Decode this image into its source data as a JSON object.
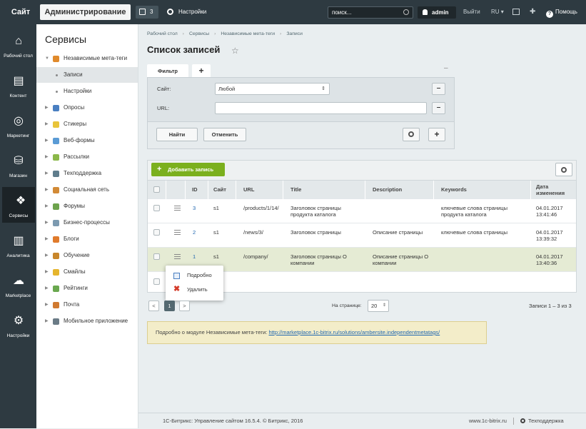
{
  "topbar": {
    "site_label": "Сайт",
    "admin_label": "Администрирование",
    "notifications_count": "3",
    "settings_label": "Настройки",
    "search_placeholder": "поиск...",
    "user_name": "admin",
    "logout_label": "Выйти",
    "lang_label": "RU",
    "help_label": "Помощь"
  },
  "leftnav": [
    {
      "label": "Рабочий стол",
      "icon": "home-icon"
    },
    {
      "label": "Контент",
      "icon": "document-icon"
    },
    {
      "label": "Маркетинг",
      "icon": "target-icon"
    },
    {
      "label": "Магазин",
      "icon": "basket-icon"
    },
    {
      "label": "Сервисы",
      "icon": "layers-icon",
      "active": true
    },
    {
      "label": "Аналитика",
      "icon": "bar-chart-icon"
    },
    {
      "label": "Marketplace",
      "icon": "cloud-download-icon"
    },
    {
      "label": "Настройки",
      "icon": "gear-icon"
    }
  ],
  "sidebar": {
    "title": "Сервисы",
    "items": [
      {
        "label": "Независимые мета-теги",
        "icon": "tag-icon",
        "color": "#e08a2c",
        "expanded": true
      },
      {
        "label": "Записи",
        "sub": true,
        "active": true
      },
      {
        "label": "Настройки",
        "sub": true
      },
      {
        "label": "Опросы",
        "icon": "pie-icon",
        "color": "#4a7fc1"
      },
      {
        "label": "Стикеры",
        "icon": "sticker-icon",
        "color": "#e8c43a"
      },
      {
        "label": "Веб-формы",
        "icon": "form-icon",
        "color": "#5a9bd5"
      },
      {
        "label": "Рассылки",
        "icon": "mail-icon",
        "color": "#8bb84a"
      },
      {
        "label": "Техподдержка",
        "icon": "headset-icon",
        "color": "#5f7d8c"
      },
      {
        "label": "Социальная сеть",
        "icon": "people-icon",
        "color": "#d28a36"
      },
      {
        "label": "Форумы",
        "icon": "forum-icon",
        "color": "#6da34d"
      },
      {
        "label": "Бизнес-процессы",
        "icon": "process-icon",
        "color": "#7c9ab0"
      },
      {
        "label": "Блоги",
        "icon": "blog-icon",
        "color": "#e07b2c"
      },
      {
        "label": "Обучение",
        "icon": "book-icon",
        "color": "#c8862b"
      },
      {
        "label": "Смайлы",
        "icon": "smile-icon",
        "color": "#e5b52d"
      },
      {
        "label": "Рейтинги",
        "icon": "rating-icon",
        "color": "#6aa84f"
      },
      {
        "label": "Почта",
        "icon": "post-icon",
        "color": "#d07a30"
      },
      {
        "label": "Мобильное приложение",
        "icon": "mobile-icon",
        "color": "#6a7b86"
      }
    ]
  },
  "breadcrumbs": [
    "Рабочий стол",
    "Сервисы",
    "Независимые мета-теги",
    "Записи"
  ],
  "page_title": "Список записей",
  "filter": {
    "tab_label": "Фильтр",
    "add_tab_label": "+",
    "collapse_label": "–",
    "site_label": "Сайт:",
    "site_value": "Любой",
    "url_label": "URL:",
    "url_value": "",
    "find_label": "Найти",
    "cancel_label": "Отменить"
  },
  "grid": {
    "add_label": "Добавить запись",
    "columns": [
      "ID",
      "Сайт",
      "URL",
      "Title",
      "Description",
      "Keywords",
      "Дата изменения"
    ],
    "rows": [
      {
        "id": "3",
        "site": "s1",
        "url": "/products/1/14/",
        "title": "Заголовок страницы продукта каталога",
        "description": "",
        "keywords": "ключевые слова страницы продукта каталога",
        "date": "04.01.2017 13:41:46"
      },
      {
        "id": "2",
        "site": "s1",
        "url": "/news/3/",
        "title": "Заголовок страницы",
        "description": "Описание страницы",
        "keywords": "ключевые слова страницы",
        "date": "04.01.2017 13:39:32"
      },
      {
        "id": "1",
        "site": "s1",
        "url": "/company/",
        "title": "Заголовок страницы О компании",
        "description": "Описание страницы О компании",
        "keywords": "",
        "date": "04.01.2017 13:40:36"
      }
    ]
  },
  "context_menu": {
    "details_label": "Подробно",
    "delete_label": "Удалить"
  },
  "pagination": {
    "prev": "<",
    "current": "1",
    "next": ">",
    "per_page_label": "На странице:",
    "per_page_value": "20",
    "total_label": "Записи 1 – 3 из 3"
  },
  "info": {
    "text": "Подробно о модуле Независимые мета-теги:",
    "link": "http://marketplace.1c-bitrix.ru/solutions/ambersite.independentmetatags/"
  },
  "footer": {
    "copyright": "1С-Битрикс: Управление сайтом 16.5.4. © Битрикс, 2016",
    "site_link": "www.1c-bitrix.ru",
    "support_label": "Техподдержка"
  },
  "colors": {
    "accent_green": "#7bb01e",
    "dark_bar": "#2e3a41",
    "highlight_row": "#e5ebd4",
    "info_bg": "#f3edc9"
  }
}
